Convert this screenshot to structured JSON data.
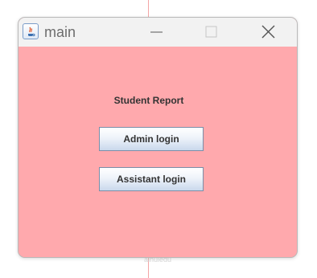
{
  "window": {
    "title": "main",
    "icon": "java-icon",
    "controls": [
      "minimize-icon",
      "maximize-icon",
      "close-icon"
    ]
  },
  "content": {
    "heading": "Student Report",
    "buttons": {
      "admin_login": "Admin login",
      "assistant_login": "Assistant login"
    }
  },
  "colors": {
    "content_background": "#ffa9ad",
    "titlebar_background": "#f2f2f2",
    "button_border": "#7a8ea8"
  },
  "background": {
    "watermark_text": "aihuiedu"
  }
}
